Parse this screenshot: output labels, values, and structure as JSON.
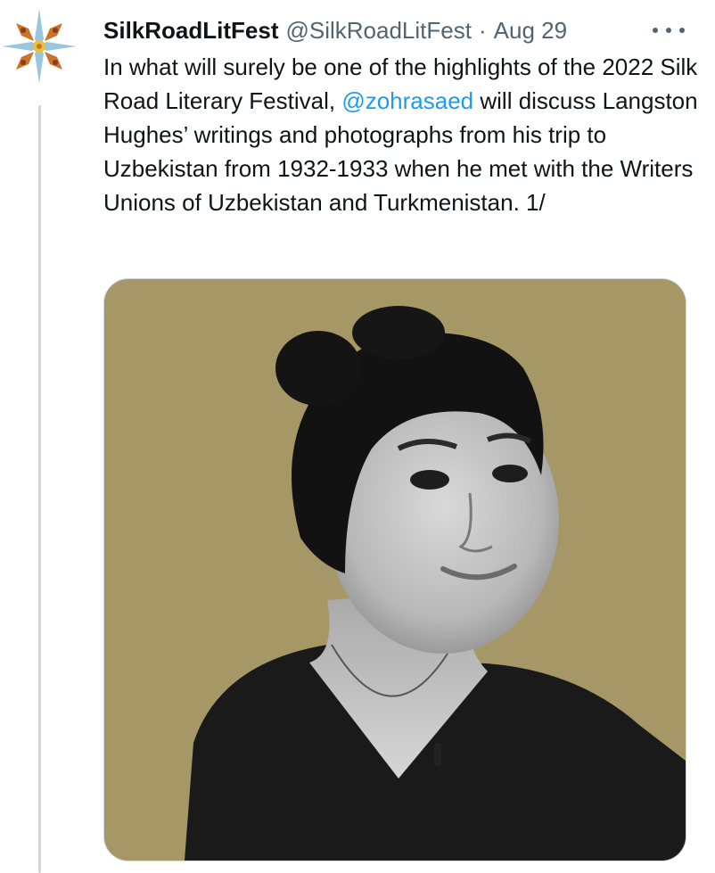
{
  "tweet": {
    "display_name": "SilkRoadLitFest",
    "handle": "@SilkRoadLitFest",
    "separator": "·",
    "date": "Aug 29",
    "text_before": "In what will surely be one of the highlights of the 2022 Silk Road Literary Festival, ",
    "mention": "@zohrasaed",
    "text_after": " will discuss Langston Hughes’ writings and photographs from his trip to Uzbekistan from 1932-1933 when he met with the Writers Unions of Uzbekistan and Turkmenistan. 1/"
  },
  "icons": {
    "avatar": "silk-road-compass-logo",
    "more": "more-horizontal-icon"
  },
  "colors": {
    "mention": "#1d9bf0",
    "secondary_text": "#536471",
    "photo_background": "#a59866",
    "thread_line": "#cfd9de"
  }
}
